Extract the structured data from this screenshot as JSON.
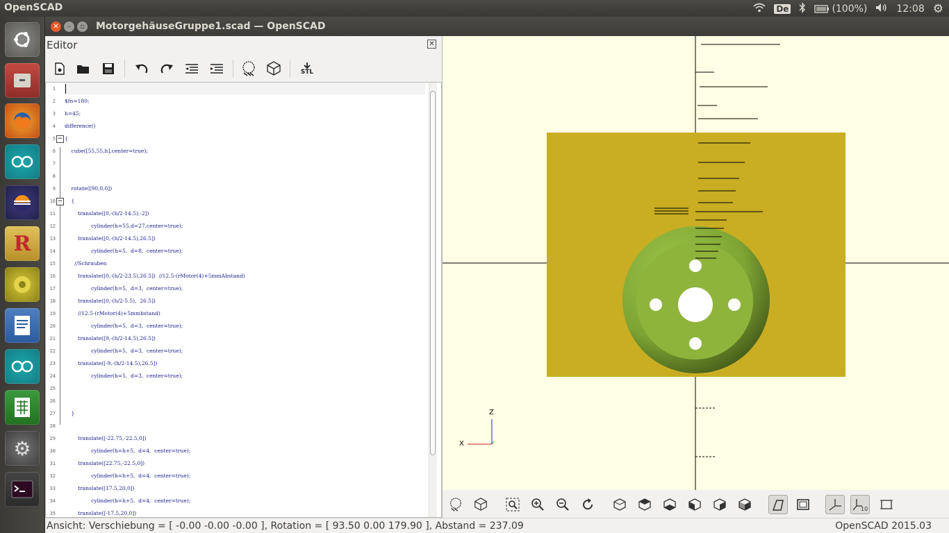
{
  "topbar": {
    "app_name": "OpenSCAD",
    "keyboard": "De",
    "battery": "(100%)",
    "time": "12:08"
  },
  "window": {
    "title": "MotorgehäuseGruppe1.scad — OpenSCAD"
  },
  "editor": {
    "label": "Editor",
    "toolbar_stl": "STL",
    "lines": [
      {
        "n": "1",
        "text": ""
      },
      {
        "n": "2",
        "text": "$fn=180;"
      },
      {
        "n": "3",
        "text": "h=45;"
      },
      {
        "n": "4",
        "text": "difference()"
      },
      {
        "n": "5",
        "text": "{"
      },
      {
        "n": "6",
        "text": "    cube([55,55,h],center=true);"
      },
      {
        "n": "7",
        "text": ""
      },
      {
        "n": "8",
        "text": ""
      },
      {
        "n": "9",
        "text": "    rotate([90,0,0])"
      },
      {
        "n": "10",
        "text": "    {"
      },
      {
        "n": "11",
        "text": "        translate([0,-(h/2-14.5),-2])"
      },
      {
        "n": "12",
        "text": "                cylinder(h=55,d=27,center=true);"
      },
      {
        "n": "13",
        "text": "        translate([0,-(h/2-14.5),26.5])"
      },
      {
        "n": "14",
        "text": "                cylinder(h=5,  d=8,  center=true);"
      },
      {
        "n": "15",
        "text": "      //Schrauben"
      },
      {
        "n": "16",
        "text": "        translate([0,-(h/2-23.5),26.5])  //12.5-(rMotor(4)+5mmAbstand)"
      },
      {
        "n": "17",
        "text": "                cylinder(h=5,  d=3,  center=true);"
      },
      {
        "n": "18",
        "text": "        translate([0,-(h/2-5.5),  26.5])"
      },
      {
        "n": "19",
        "text": "        //12.5-(rMotor(4)+5mmbstand)"
      },
      {
        "n": "20",
        "text": "                cylinder(h=5,  d=3,  center=true);"
      },
      {
        "n": "21",
        "text": "        translate([9,-(h/2-14.5),26.5])"
      },
      {
        "n": "22",
        "text": "                cylinder(h=5,  d=3,  center=true);"
      },
      {
        "n": "23",
        "text": "        translate([-9,-(h/2-14.5),26.5])"
      },
      {
        "n": "24",
        "text": "                cylinder(h=5,  d=3,  center=true);"
      },
      {
        "n": "25",
        "text": ""
      },
      {
        "n": "26",
        "text": ""
      },
      {
        "n": "27",
        "text": "    }"
      },
      {
        "n": "28",
        "text": ""
      },
      {
        "n": "29",
        "text": "        translate([-22.75,-22.5,0])"
      },
      {
        "n": "30",
        "text": "                cylinder(h=h+5,  d=4,  center=true);"
      },
      {
        "n": "31",
        "text": "        translate([22.75,-22.5,0])"
      },
      {
        "n": "32",
        "text": "                cylinder(h=h+5,  d=4,  center=true);"
      },
      {
        "n": "33",
        "text": "        translate([17.5,20,0])"
      },
      {
        "n": "34",
        "text": "                cylinder(h=h+5,  d=4,  center=true);"
      },
      {
        "n": "35",
        "text": "        translate([-17.5,20,0])"
      }
    ]
  },
  "viewport": {
    "axis_z": "Z",
    "axis_x": "X",
    "background": "#ffffe5",
    "cube_color": "#c9ad22",
    "cylinder_color": "#8fb43c"
  },
  "statusbar": {
    "view_info": "Ansicht: Verschiebung = [ -0.00 -0.00 -0.00 ], Rotation = [ 93.50 0.00 179.90 ], Abstand = 237.09",
    "version": "OpenSCAD 2015.03"
  }
}
